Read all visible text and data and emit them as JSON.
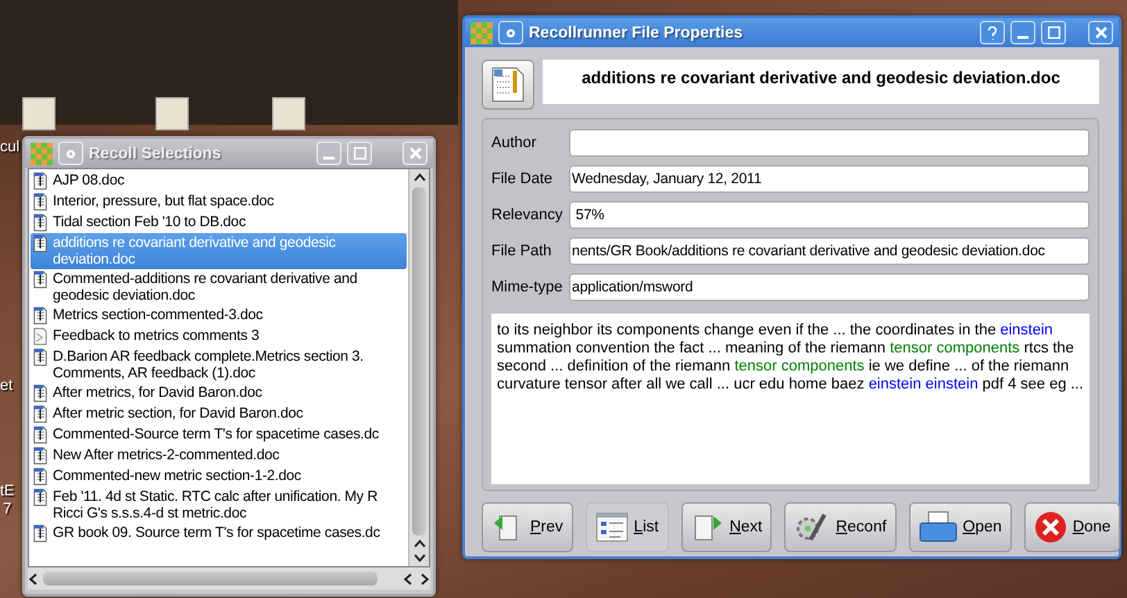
{
  "desktop": {
    "icon_labels": [
      "cul",
      "et",
      "tE\n7"
    ]
  },
  "selections_window": {
    "title": "Recoll Selections",
    "active": false,
    "items": [
      {
        "label": "AJP 08.doc",
        "kind": "doc",
        "selected": false
      },
      {
        "label": "Interior, pressure, but flat space.doc",
        "kind": "doc",
        "selected": false
      },
      {
        "label": "Tidal section Feb '10 to DB.doc",
        "kind": "doc",
        "selected": false
      },
      {
        "label": "additions re covariant derivative and geodesic deviation.doc",
        "kind": "doc",
        "selected": true
      },
      {
        "label": "Commented-additions re covariant derivative and geodesic deviation.doc",
        "kind": "doc",
        "selected": false
      },
      {
        "label": "Metrics section-commented-3.doc",
        "kind": "doc",
        "selected": false
      },
      {
        "label": "Feedback to metrics comments 3",
        "kind": "text",
        "selected": false
      },
      {
        "label": "D.Barion AR feedback complete.Metrics section 3. Comments, AR feedback (1).doc",
        "kind": "doc",
        "selected": false
      },
      {
        "label": "After metrics, for David Baron.doc",
        "kind": "doc",
        "selected": false
      },
      {
        "label": "After metric section, for David Baron.doc",
        "kind": "doc",
        "selected": false
      },
      {
        "label": "Commented-Source term T's for spacetime cases.dc",
        "kind": "doc",
        "selected": false
      },
      {
        "label": "New After metrics-2-commented.doc",
        "kind": "doc",
        "selected": false
      },
      {
        "label": "Commented-new metric section-1-2.doc",
        "kind": "doc",
        "selected": false
      },
      {
        "label": "Feb '11. 4d st Static. RTC calc after unification. My R Ricci G's s.s.s.4-d st metric.doc",
        "kind": "doc",
        "selected": false
      },
      {
        "label": "GR book 09. Source term T's for spacetime cases.dc",
        "kind": "doc",
        "selected": false
      }
    ]
  },
  "properties_window": {
    "title": "Recollrunner File Properties",
    "active": true,
    "file_name": "additions re covariant derivative and geodesic deviation.doc",
    "fields": [
      {
        "label": "Author"
      },
      {
        "label": "File Date",
        "value": "Wednesday, January 12, 2011"
      },
      {
        "label": "Relevancy",
        "value": " 57%"
      },
      {
        "label": "File Path",
        "value": "nents/GR Book/additions re covariant derivative and geodesic deviation.doc"
      },
      {
        "label": "Mime-type",
        "value": "application/msword"
      }
    ],
    "snippet": [
      {
        "text": "to its neighbor its components change even if the ... the coordinates in the ",
        "color": "#000000"
      },
      {
        "text": "einstein",
        "color": "#0000ff"
      },
      {
        "text": " summation convention the fact ... meaning of the riemann ",
        "color": "#000000"
      },
      {
        "text": "tensor components",
        "color": "#008000"
      },
      {
        "text": " rtcs the second ... definition of the riemann ",
        "color": "#000000"
      },
      {
        "text": "tensor components",
        "color": "#008000"
      },
      {
        "text": " ie we define ... of the riemann curvature tensor after all we call ... ucr edu home baez ",
        "color": "#000000"
      },
      {
        "text": "einstein einstein",
        "color": "#0000ff"
      },
      {
        "text": " pdf 4 see eg ...",
        "color": "#000000"
      }
    ],
    "buttons": [
      {
        "label": "Prev",
        "kind": "prev",
        "selected": false
      },
      {
        "label": "List",
        "kind": "list",
        "selected": true
      },
      {
        "label": "Next",
        "kind": "next",
        "selected": false
      },
      {
        "label": "Reconf",
        "kind": "reconf",
        "selected": false
      },
      {
        "label": "Open",
        "kind": "open",
        "selected": false
      },
      {
        "label": "Done",
        "kind": "done",
        "selected": false
      }
    ]
  }
}
